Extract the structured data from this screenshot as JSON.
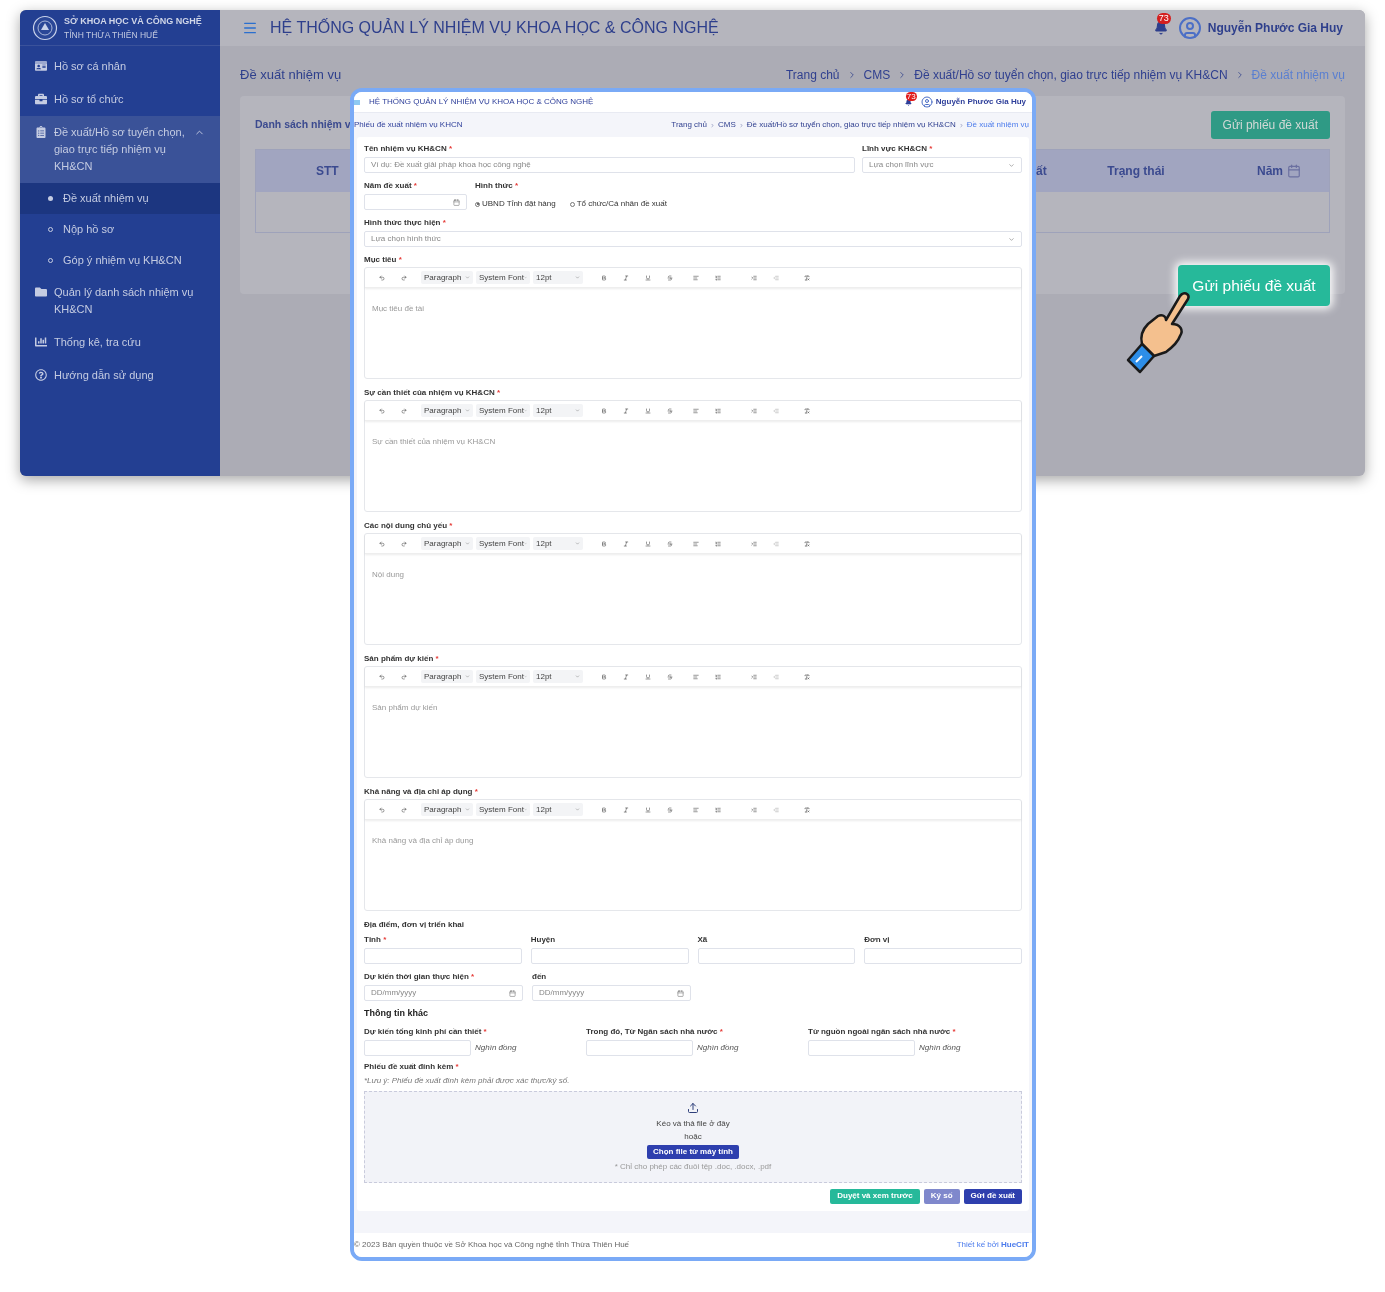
{
  "app_header": {
    "org_line1": "SỞ KHOA HỌC VÀ CÔNG NGHỆ",
    "org_line2": "TỈNH THỪA THIÊN HUẾ",
    "title": "HỆ THỐNG QUẢN LÝ NHIỆM VỤ KHOA HỌC & CÔNG NGHỆ",
    "notification_count": "73",
    "user_name": "Nguyễn Phước Gia Huy"
  },
  "sidebar": {
    "items": [
      {
        "label": "Hồ sơ cá nhân",
        "selected": false
      },
      {
        "label": "Hồ sơ tổ chức",
        "selected": false
      },
      {
        "label": "Đề xuất/Hồ sơ tuyển chọn, giao trực tiếp nhiệm vụ KH&CN",
        "selected": false,
        "expanded": true,
        "children": [
          {
            "label": "Đề xuất nhiệm vụ",
            "selected": true
          },
          {
            "label": "Nộp hồ sơ",
            "selected": false
          },
          {
            "label": "Góp ý nhiệm vụ KH&CN",
            "selected": false
          }
        ]
      },
      {
        "label": "Quản lý danh sách nhiệm vụ KH&CN",
        "selected": false
      },
      {
        "label": "Thống kê, tra cứu",
        "selected": false
      },
      {
        "label": "Hướng dẫn sử dụng",
        "selected": false
      }
    ]
  },
  "page": {
    "title": "Đề xuất nhiệm vụ",
    "breadcrumb": [
      "Trang chủ",
      "CMS",
      "Đề xuất/Hồ sơ tuyển chọn, giao trực tiếp nhiệm vụ KH&CN",
      "Đề xuất nhiệm vụ"
    ],
    "card_title": "Danh sách nhiệm v",
    "submit_button": "Gửi phiếu đề xuất",
    "columns": [
      "STT",
      "ất",
      "Trạng thái",
      "Năm"
    ]
  },
  "inner": {
    "header": {
      "title": "HỆ THỐNG QUẢN LÝ NHIỆM VỤ KHOA HỌC & CÔNG NGHỆ",
      "notification_count": "73",
      "user_name": "Nguyễn Phước Gia Huy"
    },
    "page_title": "Phiếu đề xuất nhiệm vụ KHCN",
    "breadcrumb": [
      "Trang chủ",
      "CMS",
      "Đề xuất/Hồ sơ tuyển chọn, giao trực tiếp nhiệm vụ KH&CN",
      "Đề xuất nhiệm vụ"
    ],
    "form": {
      "task_name": {
        "label": "Tên nhiệm vụ KH&CN",
        "required_mark": "*",
        "placeholder": "Ví dụ: Đề xuất giải pháp khoa học công nghệ"
      },
      "field": {
        "label": "Lĩnh vực KH&CN",
        "required_mark": "*",
        "placeholder": "Lựa chọn lĩnh vực"
      },
      "year": {
        "label": "Năm đề xuất",
        "required_mark": "*"
      },
      "form_type": {
        "label": "Hình thức",
        "required_mark": "*",
        "options": [
          {
            "label": "UBND Tỉnh đặt hàng",
            "selected": true
          },
          {
            "label": "Tổ chức/Cá nhân đề xuất",
            "selected": false
          }
        ]
      },
      "method": {
        "label": "Hình thức thực hiện",
        "required_mark": "*",
        "placeholder": "Lựa chọn hình thức"
      },
      "editors": [
        {
          "label": "Mục tiêu",
          "required_mark": "*",
          "placeholder": "Mục tiêu đề tài",
          "toolbar": {
            "block": "Paragraph",
            "font": "System Font",
            "size": "12pt"
          }
        },
        {
          "label": "Sự cần thiết của nhiệm vụ KH&CN",
          "required_mark": "*",
          "placeholder": "Sự cần thiết của nhiệm vụ KH&CN",
          "toolbar": {
            "block": "Paragraph",
            "font": "System Font",
            "size": "12pt"
          }
        },
        {
          "label": "Các nội dung chủ yếu",
          "required_mark": "*",
          "placeholder": "Nội dung",
          "toolbar": {
            "block": "Paragraph",
            "font": "System Font",
            "size": "12pt"
          }
        },
        {
          "label": "Sản phẩm dự kiến",
          "required_mark": "*",
          "placeholder": "Sản phẩm dự kiến",
          "toolbar": {
            "block": "Paragraph",
            "font": "System Font",
            "size": "12pt"
          }
        },
        {
          "label": "Khả năng và địa chỉ áp dụng",
          "required_mark": "*",
          "placeholder": "Khả năng và địa chỉ áp dụng",
          "toolbar": {
            "block": "Paragraph",
            "font": "System Font",
            "size": "12pt"
          }
        }
      ],
      "location": {
        "label": "Địa điểm, đơn vị triển khai",
        "fields": [
          {
            "label": "Tỉnh",
            "required_mark": "*"
          },
          {
            "label": "Huyện"
          },
          {
            "label": "Xã"
          },
          {
            "label": "Đơn vị"
          }
        ]
      },
      "dates": [
        {
          "label": "Dự kiến thời gian thực hiện",
          "required_mark": "*",
          "placeholder": "DD/mm/yyyy"
        },
        {
          "label": "đến",
          "placeholder": "DD/mm/yyyy"
        }
      ],
      "other": {
        "title": "Thông tin khác",
        "fields": [
          {
            "label": "Dự kiến tổng kinh phí cần thiết",
            "required_mark": "*",
            "unit": "Nghìn đồng"
          },
          {
            "label": "Trong đó, Từ Ngân sách nhà nước",
            "required_mark": "*",
            "unit": "Nghìn đồng"
          },
          {
            "label": "Từ nguồn ngoài ngân sách nhà nước",
            "required_mark": "*",
            "unit": "Nghìn đồng"
          }
        ]
      },
      "attachment": {
        "label": "Phiếu đề xuất đính kèm",
        "required_mark": "*",
        "note": "*Lưu ý: Phiếu đề xuất đính kèm phải được xác thực/ký số.",
        "drop_text": "Kéo và thả file ở đây",
        "or_text": "hoặc",
        "choose_button": "Chọn file từ máy tính",
        "hint": "* Chỉ cho phép các đuôi tệp .doc, .docx, .pdf"
      },
      "actions": [
        {
          "label": "Duyệt và xem trước",
          "kind": "success"
        },
        {
          "label": "Ký số",
          "kind": "secondary"
        },
        {
          "label": "Gửi đề xuất",
          "kind": "primary"
        }
      ]
    },
    "footer": {
      "copyright": "© 2023 Bản quyền thuộc về Sở Khoa học và Công nghệ tỉnh Thừa Thiên Huế",
      "credit": "Thiết kế bởi **HueCIT**"
    }
  },
  "highlight_button": "Gửi phiếu đề xuất"
}
